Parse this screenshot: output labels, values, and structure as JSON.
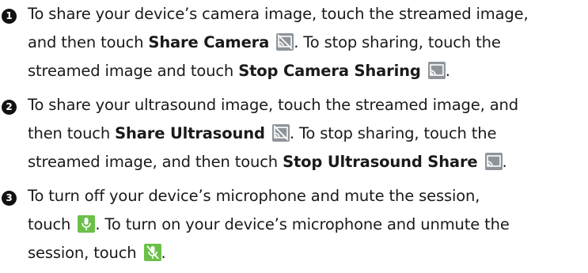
{
  "steps": [
    {
      "number": "1",
      "line1": "To share your device’s camera image, touch the streamed image,",
      "line2_pre": "and then touch ",
      "line2_bold": "Share Camera",
      "line2_post": ". To stop sharing, touch the",
      "line3_pre": "streamed image and touch ",
      "line3_bold": "Stop Camera Sharing",
      "line3_post": ".",
      "icon_a": "cast-off-icon",
      "icon_b": "cast-icon"
    },
    {
      "number": "2",
      "line1": "To share your ultrasound image, touch the streamed image, and",
      "line2_pre": "then touch ",
      "line2_bold": "Share Ultrasound",
      "line2_post": ". To stop sharing, touch the",
      "line3_pre": "streamed image, and then touch ",
      "line3_bold": "Stop Ultrasound Share",
      "line3_post": ".",
      "icon_a": "cast-off-icon",
      "icon_b": "cast-icon"
    },
    {
      "number": "3",
      "line1": "To turn off your device’s microphone and mute the session,",
      "line2_pre": "touch ",
      "line2_post": ". To turn on your device’s microphone and unmute the",
      "line3_pre": "session, touch ",
      "line3_post": ".",
      "icon_a": "microphone-icon",
      "icon_b": "microphone-off-icon"
    }
  ],
  "colors": {
    "icon_gray": "#8e949a",
    "icon_green": "#6cc04a",
    "bullet": "#111111"
  }
}
